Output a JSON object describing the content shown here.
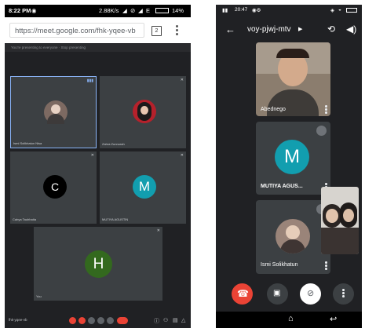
{
  "left": {
    "status": {
      "time": "8:22 PM",
      "speed": "2.88K/s",
      "network": "E",
      "battery": "14%"
    },
    "url": "https://meet.google.com/fhk-yqee-vb",
    "tab_count": "2",
    "notice": "You're presenting to everyone · Stop presenting",
    "participants": [
      {
        "name": "Ismi Solikhatun Nisa",
        "initial": "",
        "color": "#7d6a62"
      },
      {
        "name": "Zahra Zunnurah",
        "initial": "",
        "color": "#b5212b"
      },
      {
        "name": "Cahya Tauhhatia",
        "initial": "C",
        "color": "#000000"
      },
      {
        "name": "MUTIYA AGUSTIN",
        "initial": "M",
        "color": "#129eaf"
      },
      {
        "name": "You",
        "initial": "H",
        "color": "#33691e"
      }
    ],
    "meeting_code": "fhk-yqee-vb"
  },
  "right": {
    "status": {
      "time": "20:47"
    },
    "meeting_code": "voy-pjwj-mtv",
    "participants": [
      {
        "name": "Abednego",
        "initial": "",
        "color": "#8b7d6e"
      },
      {
        "name": "MUTIYA AGUS...",
        "initial": "M",
        "color": "#129eaf"
      },
      {
        "name": "Ismi Solikhatun",
        "initial": "",
        "color": "#9a8479"
      }
    ],
    "colors": {
      "end_call": "#ea4335",
      "tile": "#3c4043",
      "background": "#202124"
    }
  }
}
